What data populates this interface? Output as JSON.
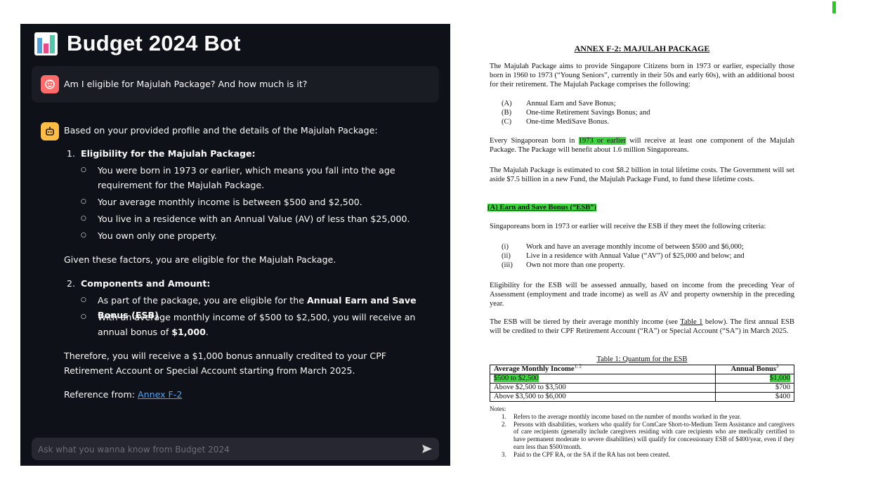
{
  "app": {
    "title": "Budget 2024 Bot",
    "user_message": "Am I eligible for Majulah Package? And how much is it?",
    "bot": {
      "intro": "Based on your provided profile and the details of the Majulah Package:",
      "item1_num": "1.",
      "item1_title": "Eligibility for the Majulah Package:",
      "item1_bullets": [
        "You were born in 1973 or earlier, which means you fall into the age requirement for the Majulah Package.",
        "Your average monthly income is between $500 and $2,500.",
        "You live in a residence with an Annual Value (AV) of less than $25,000.",
        "You own only one property."
      ],
      "given": "Given these factors, you are eligible for the Majulah Package.",
      "item2_num": "2.",
      "item2_title": "Components and Amount:",
      "item2_b1_pre": "As part of the package, you are eligible for the ",
      "item2_b1_bold": "Annual Earn and Save Bonus (ESB)",
      "item2_b1_post": ".",
      "item2_b2_pre": "With an average monthly income of $500 to $2,500, you will receive an annual bonus of ",
      "item2_b2_bold": "$1,000",
      "item2_b2_post": ".",
      "therefore": "Therefore, you will receive a $1,000 bonus annually credited to your CPF Retirement Account or Special Account starting from March 2025.",
      "reference_label": "Reference from: ",
      "reference_link": "Annex F-2"
    },
    "input_placeholder": "Ask what you wanna know from Budget 2024",
    "colors": {
      "background": "#0e1117",
      "user_avatar": "#ff6b6b",
      "bot_avatar": "#ffbd45",
      "link": "#4da3ff"
    },
    "icons": {
      "user_avatar": "smiley-face-icon",
      "bot_avatar": "robot-icon",
      "send": "send-arrow-icon",
      "logo": "bar-chart-icon"
    }
  },
  "doc": {
    "title": "ANNEX F-2: MAJULAH PACKAGE",
    "p1": "The Majulah Package aims to provide Singapore Citizens born in 1973 or earlier, especially those born in 1960 to 1973 (“Young Seniors”, currently in their 50s and early 60s), with an additional boost for their retirement. The Majulah Package comprises the following:",
    "components": [
      {
        "label": "(A)",
        "text": "Annual Earn and Save Bonus;"
      },
      {
        "label": "(B)",
        "text": "One-time Retirement Savings Bonus; and"
      },
      {
        "label": "(C)",
        "text": "One-time MediSave Bonus."
      }
    ],
    "p2_pre": "Every Singaporean born in ",
    "p2_hl": "1973 or earlier",
    "p2_post": " will receive at least one component of the Majulah Package. The Package will benefit about 1.6 million Singaporeans.",
    "p3": "The Majulah Package is estimated to cost $8.2 billion in total lifetime costs. The Government will set aside $7.5 billion in a new Fund, the Majulah Package Fund, to fund these lifetime costs.",
    "section_a": "(A) Earn and Save Bonus (“ESB”)",
    "p4": "Singaporeans born in 1973 or earlier will receive the ESB if they meet the following criteria:",
    "criteria": [
      {
        "label": "(i)",
        "text": "Work and have an average monthly income of between $500 and $6,000;"
      },
      {
        "label": "(ii)",
        "text": "Live in a residence with Annual Value (“AV”) of $25,000 and below; and"
      },
      {
        "label": "(iii)",
        "text": "Own not more than one property."
      }
    ],
    "p5": "Eligibility for the ESB will be assessed annually, based on income from the preceding Year of Assessment (employment and trade income) as well as AV and property ownership in the preceding year.",
    "p6_pre": "The ESB will be tiered by their average monthly income (see ",
    "p6_link": "Table 1",
    "p6_post": " below). The first annual ESB will be credited to their CPF Retirement Account (“RA”) or Special Account (“SA”) in March 2025.",
    "table_caption": "Table 1: Quantum for the ESB",
    "table": {
      "headers": [
        "Average Monthly Income",
        "Annual Bonus"
      ],
      "header_sups": [
        "1, 2",
        "3"
      ],
      "rows": [
        [
          "$500 to $2,500",
          "$1,000"
        ],
        [
          "Above $2,500 to $3,500",
          "$700"
        ],
        [
          "Above $3,500 to $6,000",
          "$400"
        ]
      ]
    },
    "notes_label": "Notes:",
    "notes": [
      {
        "n": "1.",
        "text": "Refers to the average monthly income based on the number of months worked in the year."
      },
      {
        "n": "2.",
        "text": "Persons with disabilities, workers who qualify for ComCare Short-to-Medium Term Assistance and caregivers of care recipients (generally include caregivers residing with care recipients who are medically certified to have permanent moderate to severe disabilities) will qualify for concessionary ESB of $400/year, even if they earn less than $500/month."
      },
      {
        "n": "3.",
        "text": "Paid to the CPF RA, or the SA if the RA has not been created."
      }
    ],
    "highlight_color": "#3ed43e"
  }
}
